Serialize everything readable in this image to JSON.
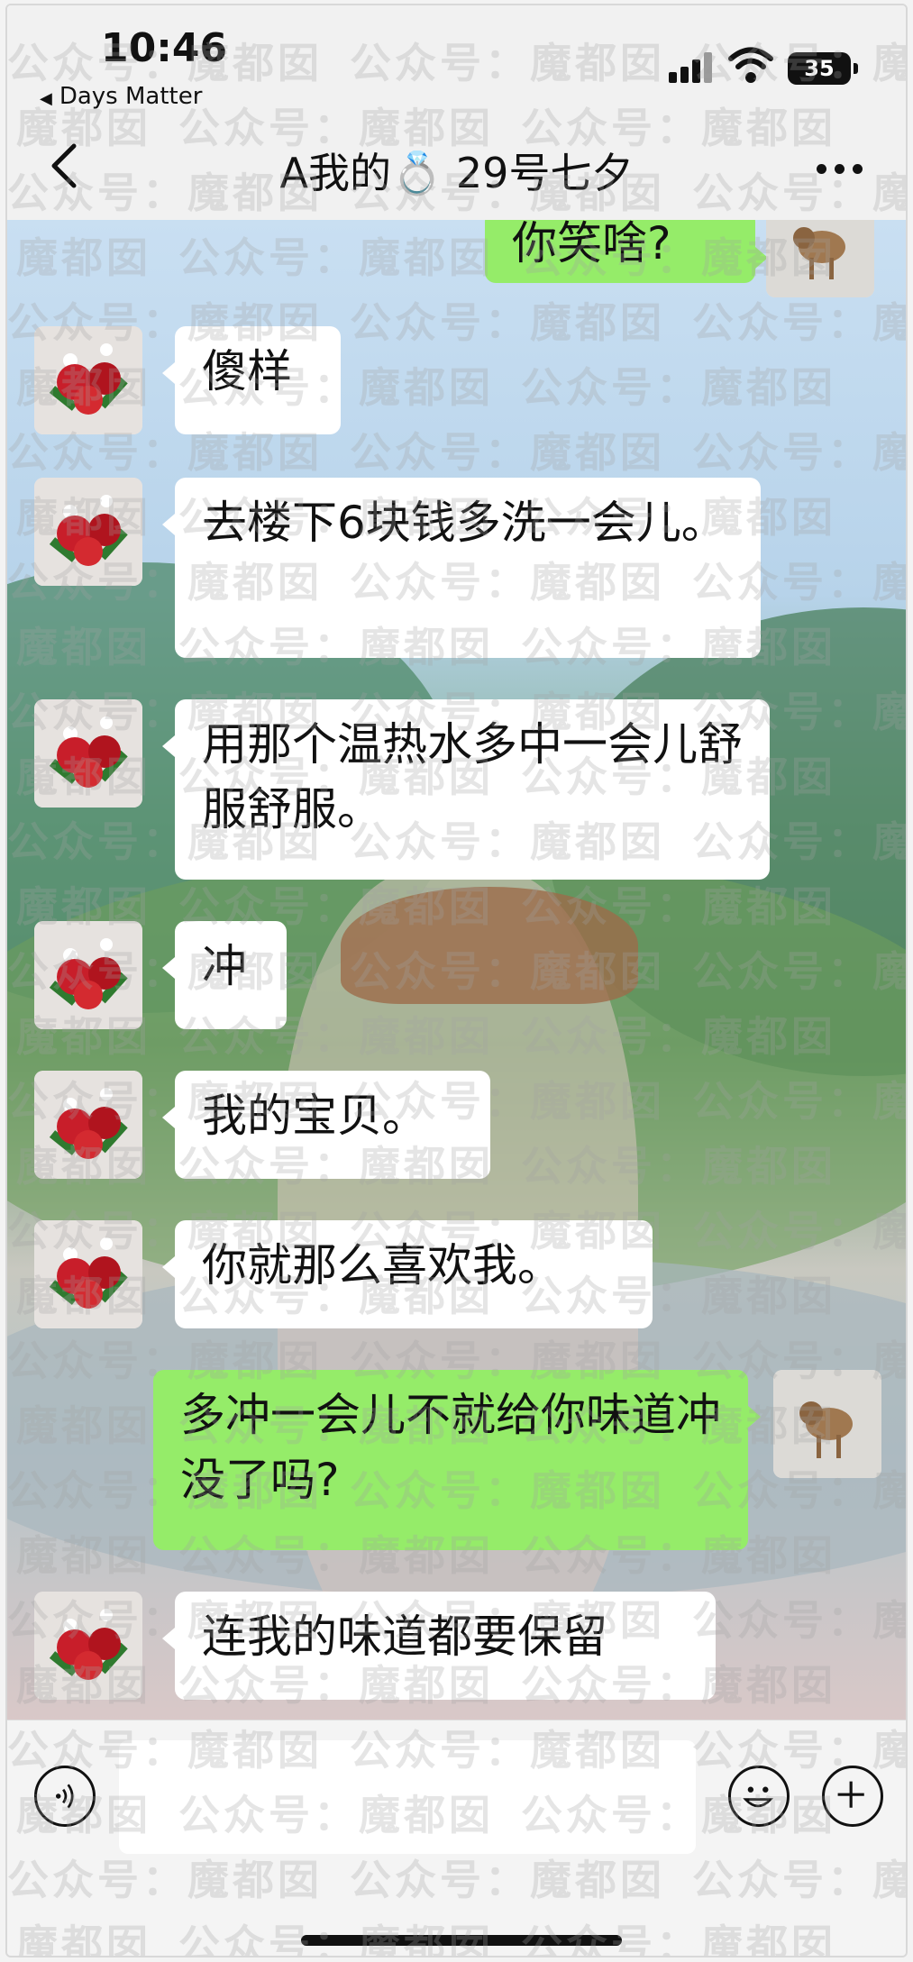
{
  "status_bar": {
    "time": "10:46",
    "back_app": "Days Matter",
    "battery": "35"
  },
  "nav": {
    "title": "A我的💍 29号七夕",
    "back_icon": "chevron-left-icon",
    "more_icon": "more-dots-icon"
  },
  "messages": [
    {
      "side": "out",
      "text": "你笑啥?"
    },
    {
      "side": "in",
      "text": "傻样"
    },
    {
      "side": "in",
      "text": "去楼下6块钱多洗一会儿。"
    },
    {
      "side": "in",
      "text": "用那个温热水多中一会儿舒服舒服。"
    },
    {
      "side": "in",
      "text": "冲"
    },
    {
      "side": "in",
      "text": "我的宝贝。"
    },
    {
      "side": "in",
      "text": "你就那么喜欢我。"
    },
    {
      "side": "out",
      "text": "多冲一会儿不就给你味道冲没了吗?"
    },
    {
      "side": "in",
      "text": "连我的味道都要保留"
    }
  ],
  "avatars": {
    "contact": "rose-bouquet-avatar",
    "self": "dog-avatar"
  },
  "input_bar": {
    "voice_icon": "voice-icon",
    "emoji_icon": "emoji-icon",
    "plus_icon": "plus-icon"
  },
  "watermark": "公众号：魔都囡",
  "colors": {
    "outgoing_bubble": "#95ec69",
    "incoming_bubble": "#ffffff",
    "bar_background": "#f1f1f1"
  }
}
